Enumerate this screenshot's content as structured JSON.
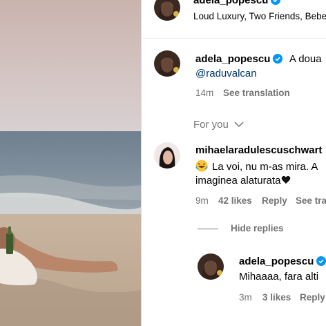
{
  "header": {
    "username": "adela_popescu",
    "audio_title": "Loud Luxury, Two Friends, Bebe"
  },
  "comments": [
    {
      "username": "adela_popescu",
      "text": "A doua",
      "mention": "@raduvalcan",
      "time": "14m",
      "see_translation": "See translation"
    }
  ],
  "section_label": "For you",
  "thread": {
    "username": "mihaelaradulescuschwart",
    "line1": "La voi, nu m-as mira. A",
    "line2": "imaginea alaturata",
    "time": "9m",
    "likes": "42 likes",
    "reply": "Reply",
    "see_translation": "See tra"
  },
  "hide_replies": "Hide replies",
  "reply": {
    "username": "adela_popescu",
    "text": "Mihaaaa, fara alti",
    "time": "3m",
    "likes": "3 likes",
    "reply": "Reply"
  },
  "colors": {
    "verified": "#0095f6",
    "link": "#00376b",
    "secondary_text": "#737373"
  }
}
